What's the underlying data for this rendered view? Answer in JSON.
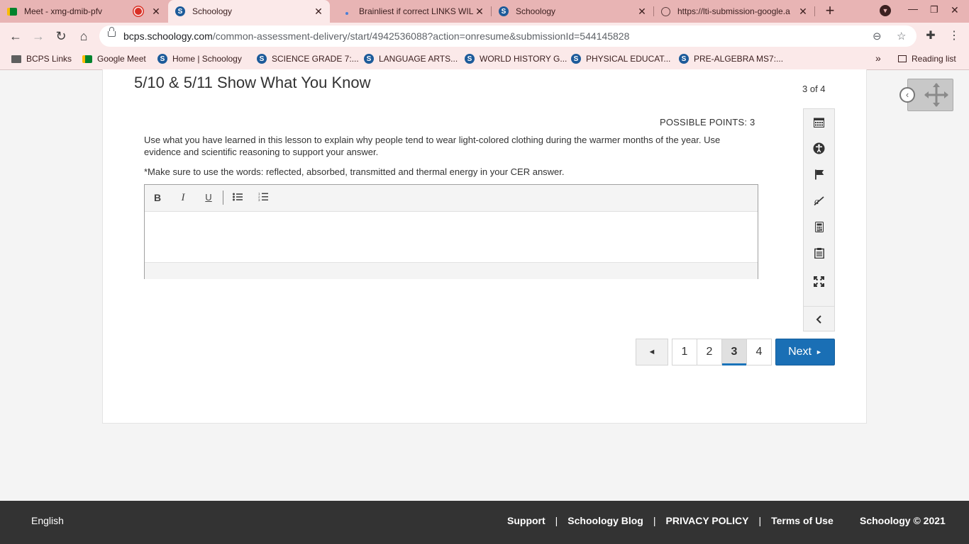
{
  "browser": {
    "tabs": [
      {
        "title": "Meet - xmg-dmib-pfv",
        "icon": "google-meet-icon"
      },
      {
        "title": "Schoology",
        "icon": "schoology-icon"
      },
      {
        "title": "Brainliest if correct LINKS WIL",
        "icon": "brainly-icon"
      },
      {
        "title": "Schoology",
        "icon": "schoology-icon"
      },
      {
        "title": "https://lti-submission-google.a",
        "icon": "globe-icon"
      }
    ],
    "url_host": "bcps.schoology.com",
    "url_path": "/common-assessment-delivery/start/4942536088?action=onresume&submissionId=544145828",
    "bookmarks": [
      {
        "label": "BCPS Links",
        "icon": "folder-icon"
      },
      {
        "label": "Google Meet",
        "icon": "google-meet-icon"
      },
      {
        "label": "Home | Schoology",
        "icon": "schoology-icon"
      },
      {
        "label": "SCIENCE GRADE 7:...",
        "icon": "schoology-icon"
      },
      {
        "label": "LANGUAGE ARTS...",
        "icon": "schoology-icon"
      },
      {
        "label": "WORLD HISTORY G...",
        "icon": "schoology-icon"
      },
      {
        "label": "PHYSICAL EDUCAT...",
        "icon": "schoology-icon"
      },
      {
        "label": "PRE-ALGEBRA MS7:...",
        "icon": "schoology-icon"
      }
    ],
    "reading_list": "Reading list",
    "more_bookmarks": "»"
  },
  "assessment": {
    "title": "5/10 & 5/11 Show What You Know",
    "position": "3 of 4",
    "points": "POSSIBLE POINTS: 3",
    "question": "Use what you have learned in this lesson to explain why people tend to wear light-colored clothing during the warmer months of the year.  Use evidence and scientific reasoning to support your answer.",
    "note": "*Make sure to use the words: reflected, absorbed, transmitted and thermal energy in your CER answer.",
    "answer_text": "",
    "editor_toolbar": [
      "bold-icon",
      "italic-icon",
      "underline-icon",
      "bullet-list-icon",
      "numbered-list-icon"
    ],
    "tools": [
      "calendar-icon",
      "accessibility-icon",
      "flag-icon",
      "eliminator-icon",
      "calculator-icon",
      "notepad-icon",
      "fullscreen-icon",
      "chevron-left-icon"
    ],
    "pages": [
      "1",
      "2",
      "3",
      "4"
    ],
    "current_page": "3",
    "prev_label": "◄",
    "next_label": "Next"
  },
  "footer": {
    "language": "English",
    "links": [
      "Support",
      "Schoology Blog",
      "PRIVACY POLICY",
      "Terms of Use"
    ],
    "separator": "|",
    "copyright": "Schoology © 2021"
  },
  "colors": {
    "accent": "#1a6fb5",
    "tab_strip": "#e8b4b4",
    "toolbar": "#fbe9e9",
    "footer": "#333333"
  }
}
